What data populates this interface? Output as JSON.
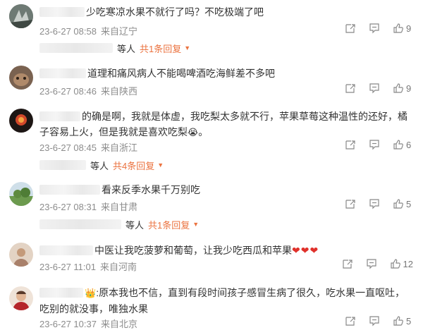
{
  "icon_names": [
    "forward-icon",
    "comment-icon",
    "like-icon"
  ],
  "comments": [
    {
      "text": "少吃寒凉水果不就行了吗？不吃极端了吧",
      "date": "23-6-27 08:58",
      "location": "来自辽宁",
      "likes": "9",
      "replies": {
        "suffix": "等人",
        "link": "共1条回复"
      }
    },
    {
      "text": "道理和痛风病人不能喝啤酒吃海鲜差不多吧",
      "date": "23-6-27 08:46",
      "location": "来自陕西",
      "likes": "9"
    },
    {
      "text": "的确是啊，我就是体虚，我吃梨太多就不行，苹果草莓这种温性的还好，橘子容易上火，但是我就是喜欢吃梨",
      "emoji": "😭",
      "text_end": "。",
      "date": "23-6-27 08:45",
      "location": "来自浙江",
      "likes": "6",
      "replies": {
        "suffix": "等人",
        "link": "共4条回复"
      }
    },
    {
      "text": "看来反季水果千万别吃",
      "date": "23-6-27 08:31",
      "location": "来自甘肃",
      "likes": "5",
      "replies": {
        "suffix": "等人",
        "link": "共1条回复"
      }
    },
    {
      "text": "中医让我吃菠萝和葡萄，让我少吃西瓜和苹果",
      "hearts": "❤❤❤",
      "date": "23-6-27 11:01",
      "location": "来自河南",
      "likes": "12"
    },
    {
      "text": ":原本我也不信，直到有段时间孩子感冒生病了很久，吃水果一直呕吐，吃别的就没事，唯独水果",
      "badge": "👑",
      "date": "23-6-27 10:37",
      "location": "来自北京",
      "likes": "5"
    }
  ]
}
